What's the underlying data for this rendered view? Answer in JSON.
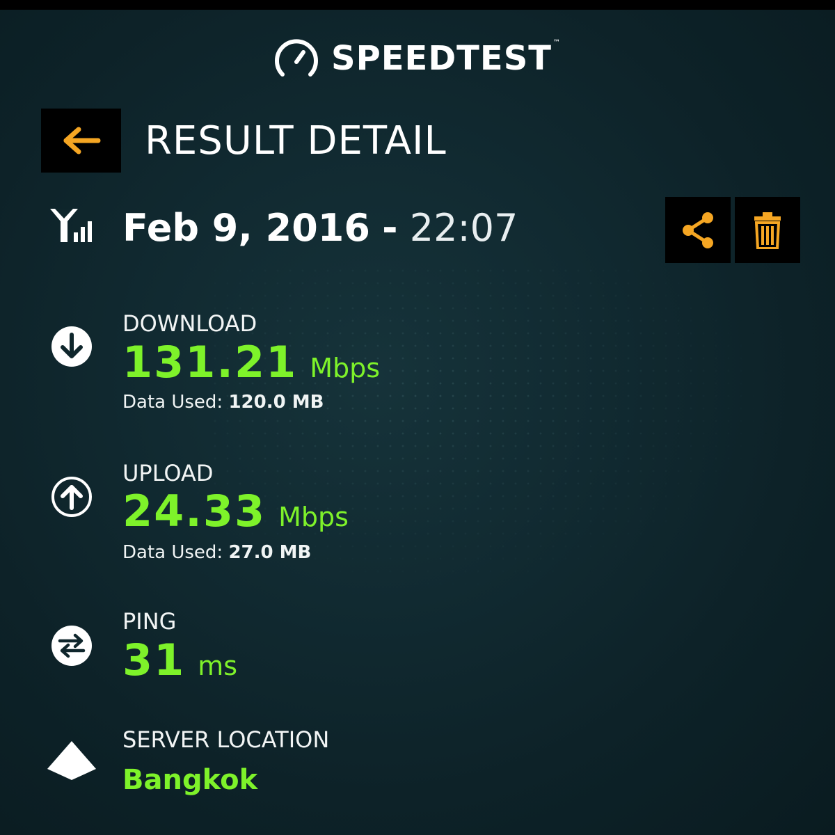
{
  "app": {
    "logo_text": "SPEEDTEST",
    "logo_tm": "™"
  },
  "header": {
    "title": "RESULT DETAIL",
    "back_icon": "arrow-left-icon"
  },
  "result": {
    "date": "Feb 9, 2016",
    "separator": "-",
    "time": "22:07",
    "connection_icon": "cell-signal-icon",
    "actions": {
      "share_icon": "share-icon",
      "delete_icon": "trash-icon"
    }
  },
  "download": {
    "label": "DOWNLOAD",
    "value": "131.21",
    "unit": "Mbps",
    "data_used_label": "Data Used:",
    "data_used_value": "120.0 MB",
    "icon": "arrow-down-circle-icon"
  },
  "upload": {
    "label": "UPLOAD",
    "value": "24.33",
    "unit": "Mbps",
    "data_used_label": "Data Used:",
    "data_used_value": "27.0 MB",
    "icon": "arrow-up-circle-icon"
  },
  "ping": {
    "label": "PING",
    "value": "31",
    "unit": "ms",
    "icon": "ping-arrows-icon"
  },
  "server": {
    "label": "SERVER LOCATION",
    "value": "Bangkok",
    "icon": "server-diamond-icon"
  },
  "colors": {
    "accent_orange": "#f5a623",
    "value_green": "#7ef22a",
    "background": "#0f262c"
  }
}
